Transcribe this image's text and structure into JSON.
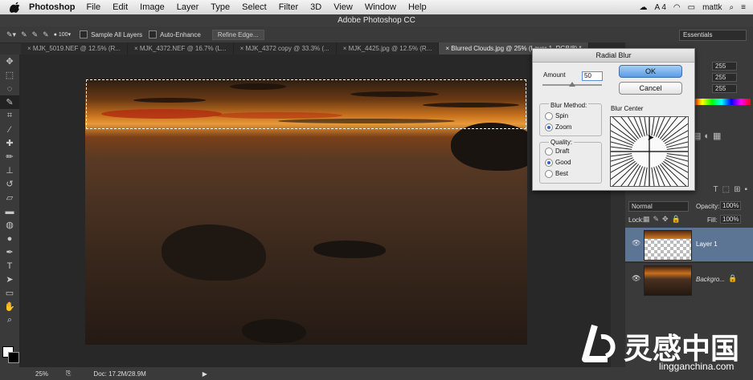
{
  "menubar": {
    "app": "Photoshop",
    "items": [
      "File",
      "Edit",
      "Image",
      "Layer",
      "Type",
      "Select",
      "Filter",
      "3D",
      "View",
      "Window",
      "Help"
    ],
    "status": [
      "A 4",
      "mattk"
    ]
  },
  "window_title": "Adobe Photoshop CC",
  "options": {
    "brush_size": "100",
    "sample_all_layers": "Sample All Layers",
    "auto_enhance": "Auto-Enhance",
    "refine_edge": "Refine Edge...",
    "workspace": "Essentials"
  },
  "tabs": [
    "MJK_5019.NEF @ 12.5% (R...",
    "MJK_4372.NEF @ 16.7% (L...",
    "MJK_4372 copy @ 33.3% (...",
    "MJK_4425.jpg @ 12.5% (R...",
    "Blurred Clouds.jpg @ 25% (Layer 1, RGB/8) *"
  ],
  "status": {
    "zoom": "25%",
    "doc": "Doc: 17.2M/28.9M"
  },
  "dialog": {
    "title": "Radial Blur",
    "amount_label": "Amount",
    "amount_value": "50",
    "ok": "OK",
    "cancel": "Cancel",
    "blur_method_label": "Blur Method:",
    "spin": "Spin",
    "zoom": "Zoom",
    "quality_label": "Quality:",
    "draft": "Draft",
    "good": "Good",
    "best": "Best",
    "blur_center_label": "Blur Center",
    "selected_method": "Zoom",
    "selected_quality": "Good"
  },
  "panel": {
    "channel_values": [
      "255",
      "255",
      "255"
    ],
    "blend_mode": "Normal",
    "opacity_label": "Opacity:",
    "opacity_value": "100%",
    "lock_label": "Lock:",
    "fill_label": "Fill:",
    "fill_value": "100%",
    "layers": [
      {
        "name": "Layer 1",
        "selected": true
      },
      {
        "name": "Backgro...",
        "selected": false
      }
    ]
  },
  "watermark": {
    "brand": "灵感中国",
    "url": "lingganchina.com"
  }
}
